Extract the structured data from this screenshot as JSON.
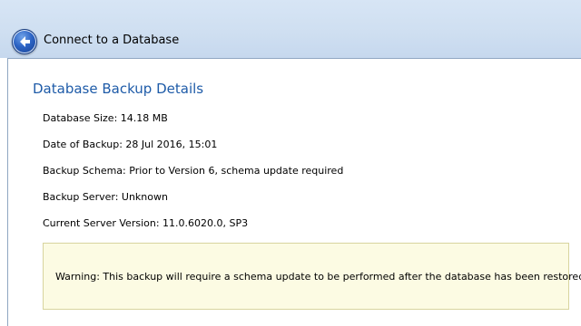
{
  "window": {
    "title": "Connect to a Database",
    "back_icon": "back-arrow-icon"
  },
  "section": {
    "title": "Database Backup Details"
  },
  "details": [
    {
      "label": "Database Size:",
      "value": "14.18 MB"
    },
    {
      "label": "Date of Backup:",
      "value": "28 Jul 2016, 15:01"
    },
    {
      "label": "Backup Schema:",
      "value": "Prior to Version 6, schema update required"
    },
    {
      "label": "Backup Server:",
      "value": "Unknown"
    },
    {
      "label": "Current Server Version:",
      "value": "11.0.6020.0, SP3"
    }
  ],
  "warning": {
    "text": "Warning: This backup will require a schema update to be performed after the database has been restored."
  },
  "colors": {
    "titlebar": "#cfdff1",
    "section_title": "#1e5ba8",
    "warning_background": "#fcfbe3",
    "warning_border": "#d8d49e"
  }
}
